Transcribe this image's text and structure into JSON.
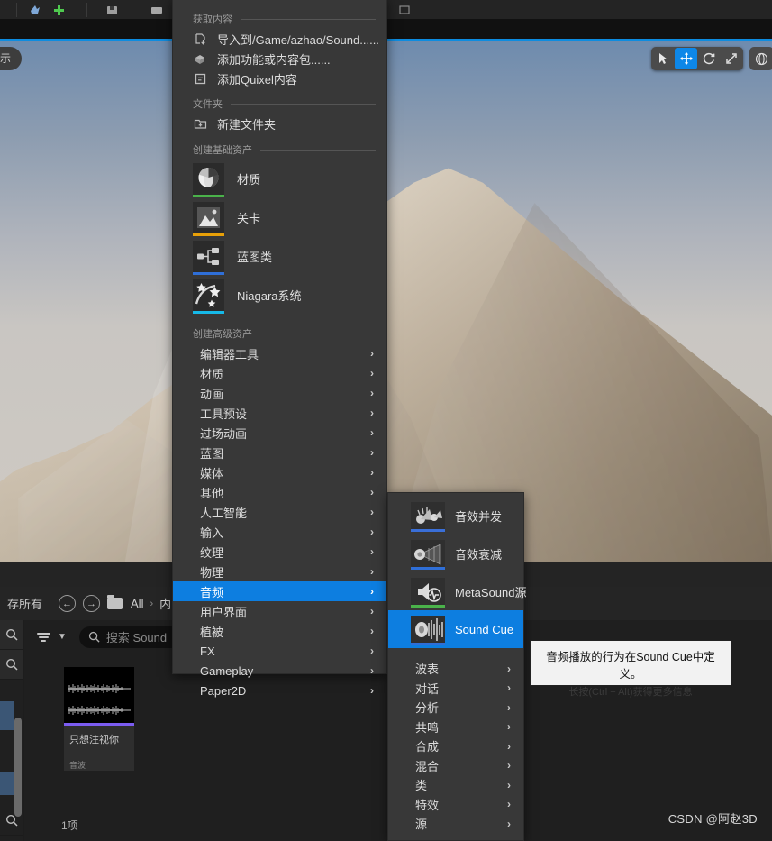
{
  "app": {
    "watermark": "CSDN @阿赵3D"
  },
  "viewport": {
    "pill_label": "示",
    "gizmo_tools": [
      {
        "name": "select-tool",
        "icon": "cursor-arrow-icon",
        "selected": false
      },
      {
        "name": "move-tool",
        "icon": "move-arrows-icon",
        "selected": true
      },
      {
        "name": "rotate-tool",
        "icon": "rotate-icon",
        "selected": false
      },
      {
        "name": "scale-tool",
        "icon": "scale-icon",
        "selected": false
      }
    ],
    "coord_tool": {
      "name": "world-space-toggle",
      "icon": "globe-icon"
    }
  },
  "content_browser": {
    "save_all_label": "存所有",
    "nav_back": "back-arrow-icon",
    "nav_forward": "forward-arrow-icon",
    "breadcrumb": [
      {
        "label": "All"
      },
      {
        "label": "内"
      }
    ],
    "breadcrumb_sep": "›",
    "filter_label": "filter-icon",
    "search": {
      "placeholder": "搜索 Sound",
      "value": ""
    },
    "asset": {
      "name": "只想注视你",
      "type": "音波",
      "accent_color": "#7b5cf0"
    },
    "status": "1项",
    "side_icons": [
      "search-icon",
      "search-icon",
      "search-icon"
    ]
  },
  "context_menu": {
    "sections": [
      {
        "title": "获取内容",
        "items": [
          {
            "label": "导入到/Game/azhao/Sound......",
            "icon": "import-icon"
          },
          {
            "label": "添加功能或内容包......",
            "icon": "add-feature-icon"
          },
          {
            "label": "添加Quixel内容",
            "icon": "quixel-icon"
          }
        ]
      },
      {
        "title": "文件夹",
        "items": [
          {
            "label": "新建文件夹",
            "icon": "new-folder-icon"
          }
        ]
      }
    ],
    "basic_assets": {
      "title": "创建基础资产",
      "items": [
        {
          "label": "材质",
          "icon": "material-sphere-icon",
          "accent": "#4ab24a"
        },
        {
          "label": "关卡",
          "icon": "level-mountain-icon",
          "accent": "#e8a008"
        },
        {
          "label": "蓝图类",
          "icon": "blueprint-node-icon",
          "accent": "#2f6fd8"
        },
        {
          "label": "Niagara系统",
          "icon": "niagara-stars-icon",
          "accent": "#16b9e8"
        }
      ]
    },
    "advanced_assets": {
      "title": "创建高级资产",
      "items": [
        {
          "label": "编辑器工具",
          "selected": false
        },
        {
          "label": "材质",
          "selected": false
        },
        {
          "label": "动画",
          "selected": false
        },
        {
          "label": "工具预设",
          "selected": false
        },
        {
          "label": "过场动画",
          "selected": false
        },
        {
          "label": "蓝图",
          "selected": false
        },
        {
          "label": "媒体",
          "selected": false
        },
        {
          "label": "其他",
          "selected": false
        },
        {
          "label": "人工智能",
          "selected": false
        },
        {
          "label": "输入",
          "selected": false
        },
        {
          "label": "纹理",
          "selected": false
        },
        {
          "label": "物理",
          "selected": false
        },
        {
          "label": "音频",
          "selected": true
        },
        {
          "label": "用户界面",
          "selected": false
        },
        {
          "label": "植被",
          "selected": false
        },
        {
          "label": "FX",
          "selected": false
        },
        {
          "label": "Gameplay",
          "selected": false
        },
        {
          "label": "Paper2D",
          "selected": false
        }
      ],
      "arrow": "›"
    }
  },
  "audio_submenu": {
    "featured": [
      {
        "label": "音效并发",
        "icon": "sound-concurrency-icon",
        "accent": "#3a6fd8",
        "selected": false
      },
      {
        "label": "音效衰减",
        "icon": "sound-attenuation-icon",
        "accent": "#2f6fd8",
        "selected": false
      },
      {
        "label": "MetaSound源",
        "icon": "metasound-icon",
        "accent": "#4ab24a",
        "selected": false
      },
      {
        "label": "Sound Cue",
        "icon": "sound-cue-icon",
        "accent": "#2f6fd8",
        "selected": true
      }
    ],
    "groups": [
      {
        "label": "波表"
      },
      {
        "label": "对话"
      },
      {
        "label": "分析"
      },
      {
        "label": "共鸣"
      },
      {
        "label": "合成"
      },
      {
        "label": "混合"
      },
      {
        "label": "类"
      },
      {
        "label": "特效"
      },
      {
        "label": "源"
      }
    ],
    "arrow": "›"
  },
  "tooltip": {
    "line1": "音频播放的行为在Sound Cue中定义。",
    "line2": "长按(Ctrl + Alt)获得更多信息"
  }
}
